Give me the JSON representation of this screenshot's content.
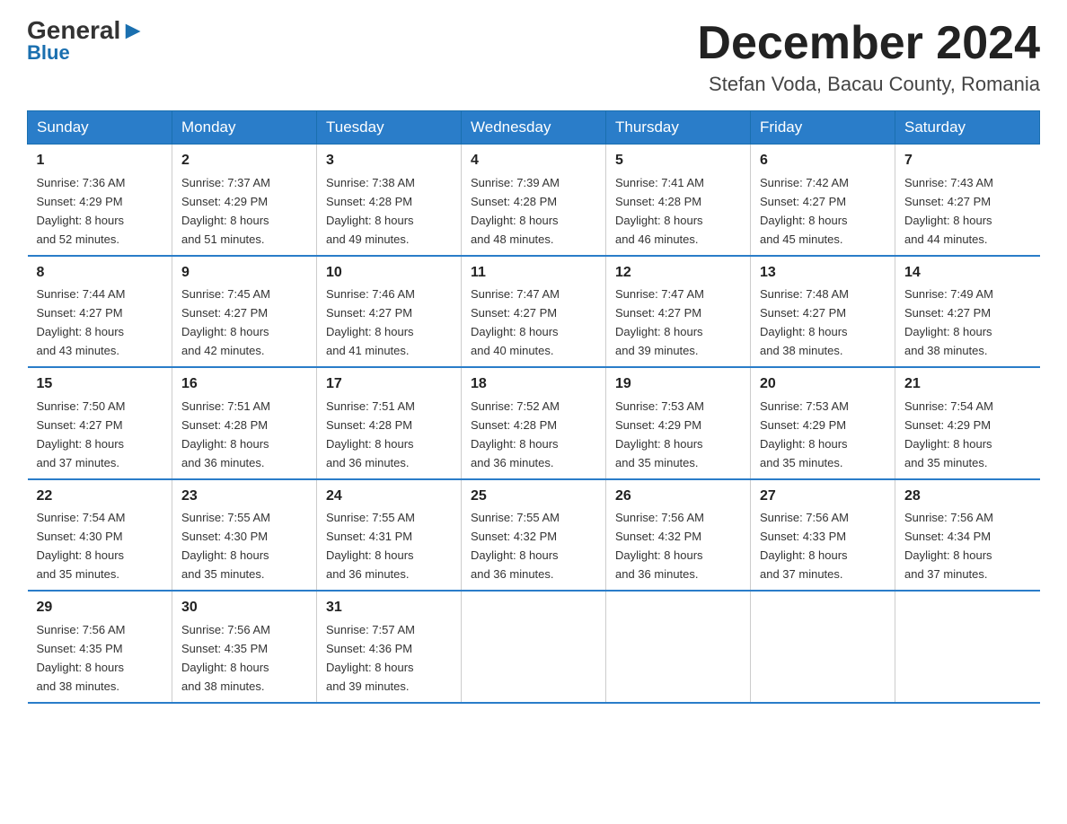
{
  "header": {
    "logo_general": "General",
    "logo_blue": "Blue",
    "month_title": "December 2024",
    "location": "Stefan Voda, Bacau County, Romania"
  },
  "days_of_week": [
    "Sunday",
    "Monday",
    "Tuesday",
    "Wednesday",
    "Thursday",
    "Friday",
    "Saturday"
  ],
  "weeks": [
    [
      {
        "day": "1",
        "sunrise": "7:36 AM",
        "sunset": "4:29 PM",
        "daylight": "8 hours and 52 minutes."
      },
      {
        "day": "2",
        "sunrise": "7:37 AM",
        "sunset": "4:29 PM",
        "daylight": "8 hours and 51 minutes."
      },
      {
        "day": "3",
        "sunrise": "7:38 AM",
        "sunset": "4:28 PM",
        "daylight": "8 hours and 49 minutes."
      },
      {
        "day": "4",
        "sunrise": "7:39 AM",
        "sunset": "4:28 PM",
        "daylight": "8 hours and 48 minutes."
      },
      {
        "day": "5",
        "sunrise": "7:41 AM",
        "sunset": "4:28 PM",
        "daylight": "8 hours and 46 minutes."
      },
      {
        "day": "6",
        "sunrise": "7:42 AM",
        "sunset": "4:27 PM",
        "daylight": "8 hours and 45 minutes."
      },
      {
        "day": "7",
        "sunrise": "7:43 AM",
        "sunset": "4:27 PM",
        "daylight": "8 hours and 44 minutes."
      }
    ],
    [
      {
        "day": "8",
        "sunrise": "7:44 AM",
        "sunset": "4:27 PM",
        "daylight": "8 hours and 43 minutes."
      },
      {
        "day": "9",
        "sunrise": "7:45 AM",
        "sunset": "4:27 PM",
        "daylight": "8 hours and 42 minutes."
      },
      {
        "day": "10",
        "sunrise": "7:46 AM",
        "sunset": "4:27 PM",
        "daylight": "8 hours and 41 minutes."
      },
      {
        "day": "11",
        "sunrise": "7:47 AM",
        "sunset": "4:27 PM",
        "daylight": "8 hours and 40 minutes."
      },
      {
        "day": "12",
        "sunrise": "7:47 AM",
        "sunset": "4:27 PM",
        "daylight": "8 hours and 39 minutes."
      },
      {
        "day": "13",
        "sunrise": "7:48 AM",
        "sunset": "4:27 PM",
        "daylight": "8 hours and 38 minutes."
      },
      {
        "day": "14",
        "sunrise": "7:49 AM",
        "sunset": "4:27 PM",
        "daylight": "8 hours and 38 minutes."
      }
    ],
    [
      {
        "day": "15",
        "sunrise": "7:50 AM",
        "sunset": "4:27 PM",
        "daylight": "8 hours and 37 minutes."
      },
      {
        "day": "16",
        "sunrise": "7:51 AM",
        "sunset": "4:28 PM",
        "daylight": "8 hours and 36 minutes."
      },
      {
        "day": "17",
        "sunrise": "7:51 AM",
        "sunset": "4:28 PM",
        "daylight": "8 hours and 36 minutes."
      },
      {
        "day": "18",
        "sunrise": "7:52 AM",
        "sunset": "4:28 PM",
        "daylight": "8 hours and 36 minutes."
      },
      {
        "day": "19",
        "sunrise": "7:53 AM",
        "sunset": "4:29 PM",
        "daylight": "8 hours and 35 minutes."
      },
      {
        "day": "20",
        "sunrise": "7:53 AM",
        "sunset": "4:29 PM",
        "daylight": "8 hours and 35 minutes."
      },
      {
        "day": "21",
        "sunrise": "7:54 AM",
        "sunset": "4:29 PM",
        "daylight": "8 hours and 35 minutes."
      }
    ],
    [
      {
        "day": "22",
        "sunrise": "7:54 AM",
        "sunset": "4:30 PM",
        "daylight": "8 hours and 35 minutes."
      },
      {
        "day": "23",
        "sunrise": "7:55 AM",
        "sunset": "4:30 PM",
        "daylight": "8 hours and 35 minutes."
      },
      {
        "day": "24",
        "sunrise": "7:55 AM",
        "sunset": "4:31 PM",
        "daylight": "8 hours and 36 minutes."
      },
      {
        "day": "25",
        "sunrise": "7:55 AM",
        "sunset": "4:32 PM",
        "daylight": "8 hours and 36 minutes."
      },
      {
        "day": "26",
        "sunrise": "7:56 AM",
        "sunset": "4:32 PM",
        "daylight": "8 hours and 36 minutes."
      },
      {
        "day": "27",
        "sunrise": "7:56 AM",
        "sunset": "4:33 PM",
        "daylight": "8 hours and 37 minutes."
      },
      {
        "day": "28",
        "sunrise": "7:56 AM",
        "sunset": "4:34 PM",
        "daylight": "8 hours and 37 minutes."
      }
    ],
    [
      {
        "day": "29",
        "sunrise": "7:56 AM",
        "sunset": "4:35 PM",
        "daylight": "8 hours and 38 minutes."
      },
      {
        "day": "30",
        "sunrise": "7:56 AM",
        "sunset": "4:35 PM",
        "daylight": "8 hours and 38 minutes."
      },
      {
        "day": "31",
        "sunrise": "7:57 AM",
        "sunset": "4:36 PM",
        "daylight": "8 hours and 39 minutes."
      },
      null,
      null,
      null,
      null
    ]
  ],
  "labels": {
    "sunrise": "Sunrise:",
    "sunset": "Sunset:",
    "daylight": "Daylight:"
  }
}
